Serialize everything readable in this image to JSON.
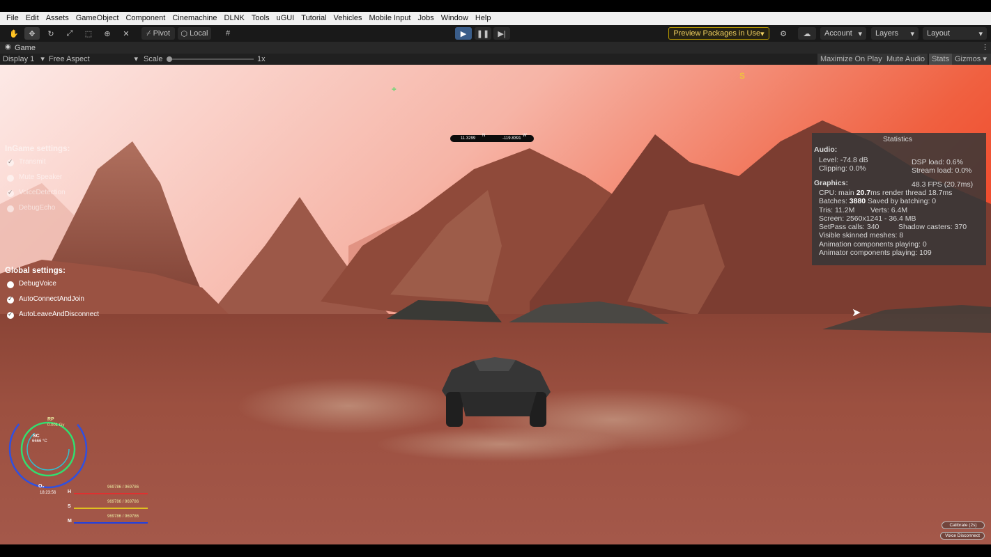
{
  "menu": [
    "File",
    "Edit",
    "Assets",
    "GameObject",
    "Component",
    "Cinemachine",
    "DLNK",
    "Tools",
    "uGUI",
    "Tutorial",
    "Vehicles",
    "Mobile Input",
    "Jobs",
    "Window",
    "Help"
  ],
  "toolbar": {
    "pivot": "Pivot",
    "local": "Local",
    "preview_packages": "Preview Packages in Use",
    "account": "Account",
    "layers": "Layers",
    "layout": "Layout"
  },
  "game_tab": {
    "label": "Game"
  },
  "game_bar": {
    "display": "Display 1",
    "aspect": "Free Aspect",
    "scale_label": "Scale",
    "scale_value": "1x",
    "maximize": "Maximize On Play",
    "mute": "Mute Audio",
    "stats": "Stats",
    "gizmos": "Gizmos"
  },
  "stats": {
    "title": "Statistics",
    "audio_header": "Audio:",
    "level": "Level: -74.8 dB",
    "clipping": "Clipping: 0.0%",
    "dsp": "DSP load: 0.6%",
    "stream": "Stream load: 0.0%",
    "graphics_header": "Graphics:",
    "fps": "48.3 FPS (20.7ms)",
    "cpu_prefix": "CPU: main ",
    "cpu_main": "20.7",
    "cpu_suffix": "ms  render thread 18.7ms",
    "batches_prefix": "Batches: ",
    "batches": "3880",
    "batches_suffix": "  Saved by batching: 0",
    "tris": "Tris: 11.2M",
    "verts": "Verts: 6.4M",
    "screen": "Screen: 2560x1241 - 36.4 MB",
    "setpass": "SetPass calls: 340",
    "shadow": "Shadow casters: 370",
    "skinned": "Visible skinned meshes: 8",
    "anim": "Animation components playing: 0",
    "animator": "Animator components playing: 109"
  },
  "ingame_settings": {
    "title": "InGame settings:",
    "items": [
      {
        "label": "Transmit",
        "checked": true
      },
      {
        "label": "Mute Speaker",
        "checked": false
      },
      {
        "label": "VoiceDetection",
        "checked": true
      },
      {
        "label": "DebugEcho",
        "checked": false
      }
    ]
  },
  "global_settings": {
    "title": "Global settings:",
    "items": [
      {
        "label": "DebugVoice",
        "checked": false
      },
      {
        "label": "AutoConnectAndJoin",
        "checked": true
      },
      {
        "label": "AutoLeaveAndDisconnect",
        "checked": true
      }
    ]
  },
  "compass": {
    "left": "11.3299",
    "n": "N",
    "right": "-119.8391",
    "w": "W"
  },
  "hud": {
    "s_marker": "S",
    "rp_label": "RP",
    "rp_value": "0.001 Gy",
    "sc_label": "SC",
    "sc_value": "6666 °C",
    "o2_label": "O₂",
    "o2_value": "18:23:56",
    "bars": [
      {
        "label": "H",
        "value": "969786 / 969786",
        "color": "#e03030"
      },
      {
        "label": "S",
        "value": "969786 / 969786",
        "color": "#e0c020"
      },
      {
        "label": "M",
        "value": "969786 / 969786",
        "color": "#2040e0"
      }
    ]
  },
  "bottom_buttons": {
    "calibrate": "Calibrate (2s)",
    "voice_disconnect": "Voice Disconnect"
  },
  "colors": {
    "accent": "#3a5d8a",
    "preview": "#f0d060",
    "sky_top": "#f04020",
    "terrain": "#9a4a3a"
  }
}
